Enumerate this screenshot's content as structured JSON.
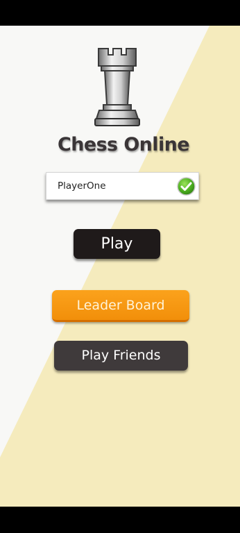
{
  "app": {
    "title": "Chess Online",
    "logo_icon": "rook-icon"
  },
  "player": {
    "name_value": "PlayerOne",
    "valid_icon": "check-icon"
  },
  "menu": {
    "play_label": "Play",
    "leaderboard_label": "Leader Board",
    "play_friends_label": "Play Friends"
  },
  "colors": {
    "background": "#f8f8f6",
    "diagonal_yellow": "#f5ebbd",
    "play_button": "#1f1a1a",
    "leaderboard_button": "#f7981a",
    "friends_button": "#3f3a3b",
    "check_green": "#4cae1f"
  }
}
